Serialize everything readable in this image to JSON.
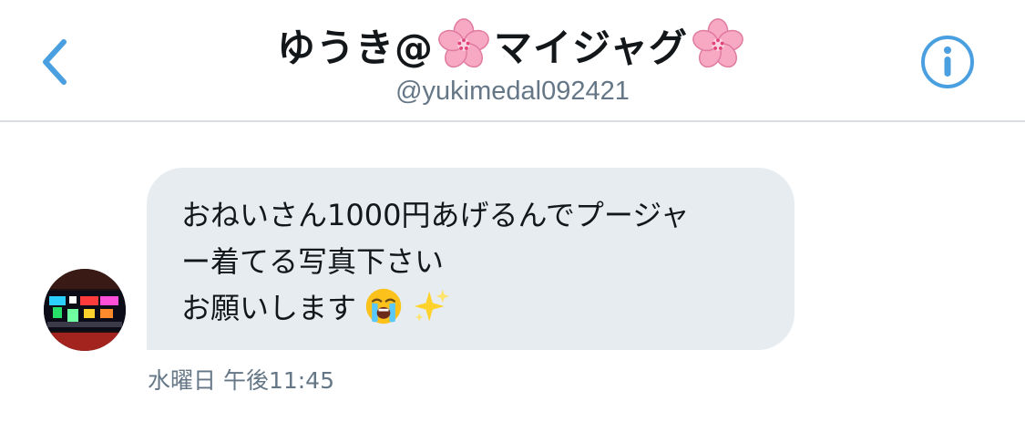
{
  "header": {
    "title_prefix": "ゆうき@",
    "title_middle": "マイジャグ",
    "handle": "@yukimedal092421",
    "back_icon": "chevron-left-icon",
    "info_icon": "info-circle-icon",
    "accent_color": "#4a9fe0"
  },
  "conversation": {
    "message": {
      "lines": [
        "おねいさん1000円あげるんでプージャ",
        "ー着てる写真下さい",
        "お願いします"
      ],
      "emojis": [
        "loudly-crying-face-emoji",
        "sparkles-emoji"
      ],
      "timestamp": "水曜日 午後11:45"
    },
    "avatar_icon": "slot-machine-avatar"
  },
  "colors": {
    "bubble": "#e6ecf0",
    "text": "#14171a",
    "secondary_text": "#657786",
    "divider": "#d9dde1"
  }
}
